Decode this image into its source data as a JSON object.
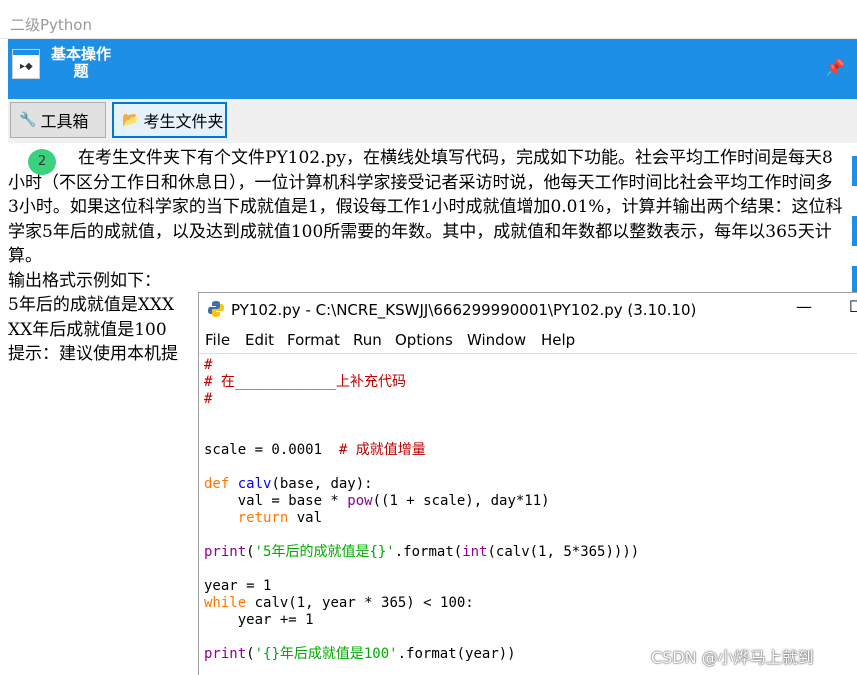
{
  "app_title": "二级Python",
  "header": {
    "title": "基本操作题"
  },
  "toolbar": {
    "toolbox_label": "工具箱",
    "folder_label": "考生文件夹"
  },
  "question": {
    "number": "2",
    "paragraphs": [
      "在考生文件夹下有个文件PY102.py，在横线处填写代码，完成如下功能。社会平均工作时间是每天8小时（不区分工作日和休息日），一位计算机科学家接受记者采访时说，他每天工作时间比社会平均工作时间多3小时。如果这位科学家的当下成就值是1，假设每工作1小时成就值增加0.01%，计算并输出两个结果：这位科学家5年后的成就值，以及达到成就值100所需要的年数。其中，成就值和年数都以整数表示，每年以365天计算。",
      "输出格式示例如下：",
      "5年后的成就值是XXX",
      "XX年后成就值是100",
      "提示：建议使用本机提"
    ]
  },
  "idle": {
    "title": "PY102.py - C:\\NCRE_KSWJJ\\666299990001\\PY102.py (3.10.10)",
    "menu": [
      "File",
      "Edit",
      "Format",
      "Run",
      "Options",
      "Window",
      "Help"
    ],
    "code": {
      "l1": "#",
      "l2": "# 在____________上补充代码",
      "l3": "#",
      "l4a": "scale = 0.0001  ",
      "l4b": "# 成就值增量",
      "l5a": "def",
      "l5b": " ",
      "l5c": "calv",
      "l5d": "(base, day):",
      "l6a": "    val = base * ",
      "l6b": "pow",
      "l6c": "((1 + scale), day*11)",
      "l7a": "    ",
      "l7b": "return",
      "l7c": " val",
      "l8a": "print",
      "l8b": "(",
      "l8c": "'5年后的成就值是{}'",
      "l8d": ".format(",
      "l8e": "int",
      "l8f": "(calv(1, 5*365))))",
      "l9": "year = 1",
      "l10a": "while",
      "l10b": " calv(1, year * 365) < 100:",
      "l11": "    year += 1",
      "l12a": "print",
      "l12b": "(",
      "l12c": "'{}年后成就值是100'",
      "l12d": ".format(year))"
    }
  },
  "watermark": "CSDN @小烨马上就到",
  "icons": {
    "window_icon": "window-icon",
    "pin": "pin-icon",
    "toolbox": "wrench-icon",
    "folder": "folder-icon",
    "python": "python-icon",
    "minimize": "minimize-icon",
    "maximize": "maximize-icon"
  },
  "colors": {
    "accent": "#1e8fe6",
    "badge": "#3ad27e",
    "comment": "#c00000",
    "keyword": "#ff7700",
    "string": "#00aa00",
    "builtin": "#900090",
    "definition": "#0000ff"
  }
}
